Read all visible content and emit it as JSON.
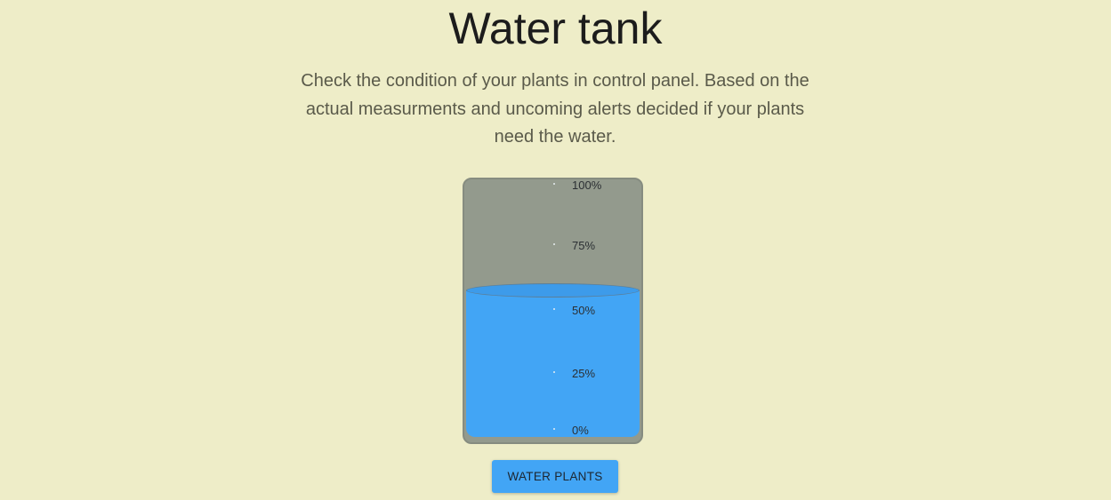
{
  "page": {
    "title": "Water tank",
    "description": "Check the condition of your plants in control panel. Based on the actual measurments and uncoming alerts decided if your plants need the water."
  },
  "tank": {
    "level_percent": 58,
    "scale": [
      "100%",
      "75%",
      "50%",
      "25%",
      "0%"
    ],
    "water_color": "#42a5f5",
    "empty_color": "#939a8d"
  },
  "actions": {
    "water_plants_label": "WATER PLANTS"
  },
  "colors": {
    "background": "#eeedc8",
    "accent": "#42a5f5"
  }
}
